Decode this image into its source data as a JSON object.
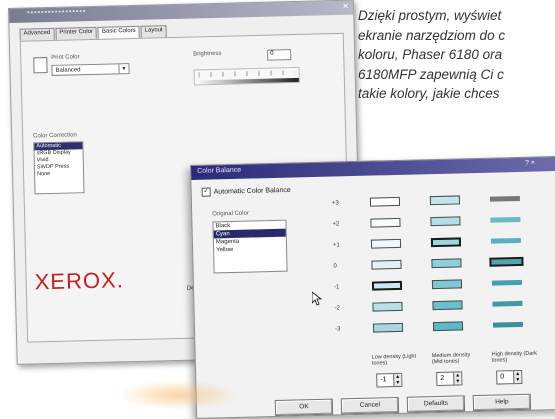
{
  "caption": {
    "lines": [
      "Dzięki prostym, wyświet",
      "ekranie narzędziom do c",
      "koloru, Phaser 6180 ora",
      "6180MFP zapewnią Ci c",
      "takie kolory, jakie chces"
    ]
  },
  "back_window": {
    "tabs": [
      "Advanced",
      "Printer Color",
      "Basic Colors",
      "Layout"
    ],
    "quality_label": "Print Color",
    "quality_value": "Balanced",
    "brightness_label": "Brightness",
    "brightness_value": "0",
    "color_label": "Color Correction",
    "color_list": [
      "Automatic",
      "sRGB Display",
      "Vivid",
      "SWOP Press",
      "None"
    ],
    "color_selected_index": 0,
    "logo": "XEROX.",
    "defaults_label": "Defaults"
  },
  "dialog": {
    "title": "Color Balance",
    "title_controls": "? ×",
    "auto_label": "Automatic Color Balance",
    "list_label": "Original Color",
    "colors": [
      "Black",
      "Cyan",
      "Magenta",
      "Yellow"
    ],
    "selected_index": 1,
    "levels": [
      "+3",
      "+2",
      "+1",
      "0",
      "-1",
      "-2",
      "-3"
    ],
    "columns": [
      {
        "label": "Low density (Light tones)",
        "value": "-1"
      },
      {
        "label": "Medium density (Mid tones)",
        "value": "2"
      },
      {
        "label": "High density (Dark tones)",
        "value": "0"
      }
    ],
    "buttons": [
      "OK",
      "Cancel",
      "Defaults",
      "Help"
    ],
    "accent": "#2a2a78",
    "cyan": "#5bb9c8"
  }
}
